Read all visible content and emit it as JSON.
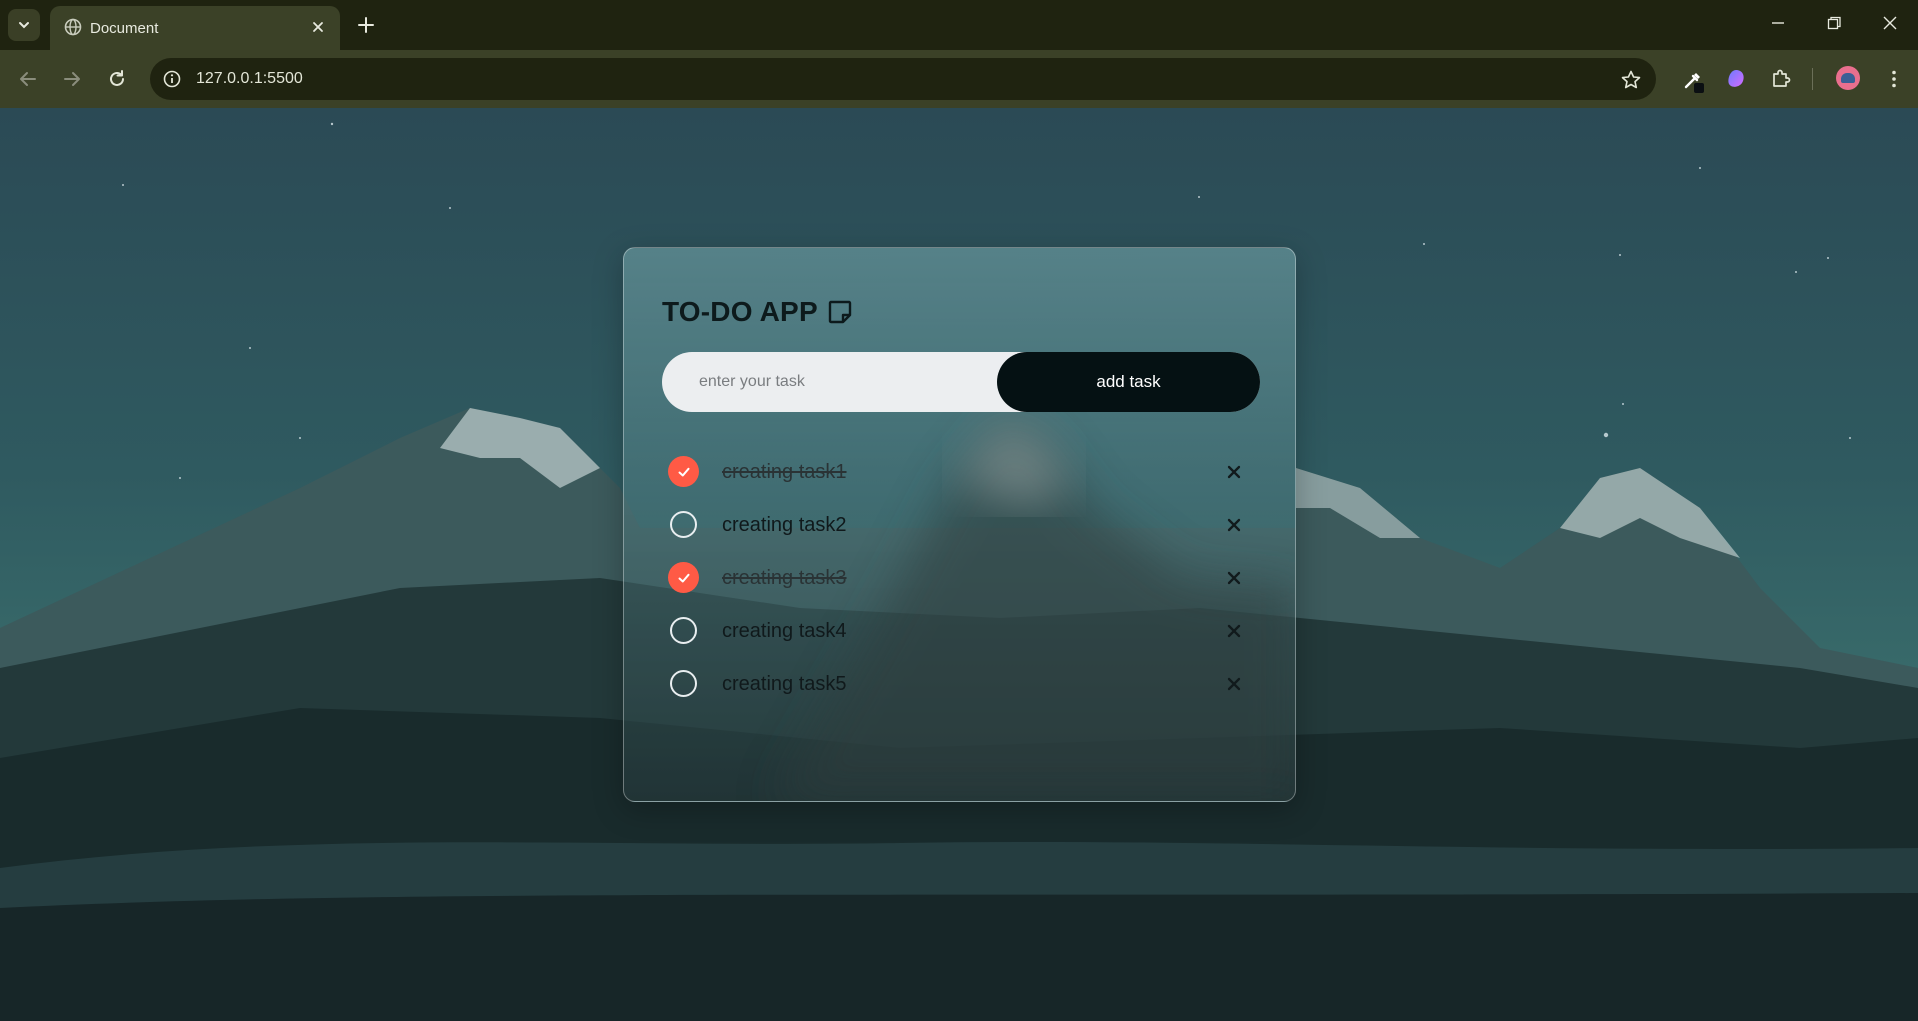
{
  "browser": {
    "tab_title": "Document",
    "url": "127.0.0.1:5500"
  },
  "app": {
    "title": "TO-DO APP",
    "input_placeholder": "enter your task",
    "add_button_label": "add task",
    "tasks": [
      {
        "label": "creating task1",
        "done": true
      },
      {
        "label": "creating task2",
        "done": false
      },
      {
        "label": "creating task3",
        "done": true
      },
      {
        "label": "creating task4",
        "done": false
      },
      {
        "label": "creating task5",
        "done": false
      }
    ]
  },
  "colors": {
    "check_done": "#ff5a45",
    "button_bg": "#051113",
    "input_bg": "#eceef0"
  },
  "icons": {
    "tab_list": "chevron-down-icon",
    "tab_favicon": "globe-icon",
    "tab_close": "close-icon",
    "new_tab": "plus-icon",
    "back": "arrow-left-icon",
    "forward": "arrow-right-icon",
    "reload": "reload-icon",
    "site_info": "info-icon",
    "bookmark": "star-icon",
    "title_icon": "sticky-note-icon",
    "remove": "close-icon"
  }
}
